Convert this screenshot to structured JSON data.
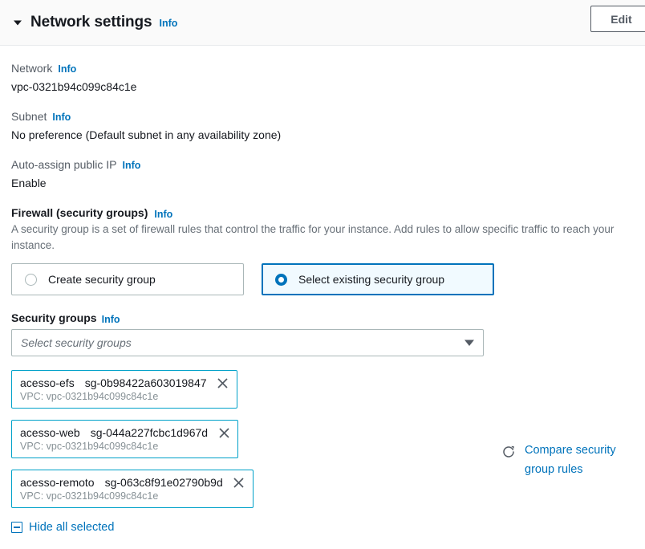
{
  "header": {
    "collapse_icon": "caret-down-icon",
    "title": "Network settings",
    "info_label": "Info",
    "edit_label": "Edit"
  },
  "fields": [
    {
      "label": "Network",
      "info_label": "Info",
      "value": "vpc-0321b94c099c84c1e"
    },
    {
      "label": "Subnet",
      "info_label": "Info",
      "value": "No preference (Default subnet in any availability zone)"
    },
    {
      "label": "Auto-assign public IP",
      "info_label": "Info",
      "value": "Enable"
    }
  ],
  "firewall": {
    "label": "Firewall (security groups)",
    "info_label": "Info",
    "description": "A security group is a set of firewall rules that control the traffic for your instance. Add rules to allow specific traffic to reach your instance.",
    "options": [
      {
        "label": "Create security group",
        "selected": false
      },
      {
        "label": "Select existing security group",
        "selected": true
      }
    ]
  },
  "security_groups": {
    "label": "Security groups",
    "info_label": "Info",
    "select_placeholder": "Select security groups",
    "caret_icon": "chevron-down-icon",
    "selected": [
      {
        "name": "acesso-efs",
        "id": "sg-0b98422a603019847",
        "vpc": "VPC: vpc-0321b94c099c84c1e",
        "remove_icon": "close-icon"
      },
      {
        "name": "acesso-web",
        "id": "sg-044a227fcbc1d967d",
        "vpc": "VPC: vpc-0321b94c099c84c1e",
        "remove_icon": "close-icon"
      },
      {
        "name": "acesso-remoto",
        "id": "sg-063c8f91e02790b9d",
        "vpc": "VPC: vpc-0321b94c099c84c1e",
        "remove_icon": "close-icon"
      }
    ],
    "compare": {
      "icon": "refresh-icon",
      "label": "Compare security group rules"
    },
    "hide_all": {
      "icon": "minus-square-icon",
      "label": "Hide all selected"
    }
  },
  "colors": {
    "link": "#0073bb",
    "token_border": "#00a1c9",
    "selected_tile_bg": "#f1faff",
    "header_bg": "#fafafa",
    "muted_text": "#687078"
  }
}
